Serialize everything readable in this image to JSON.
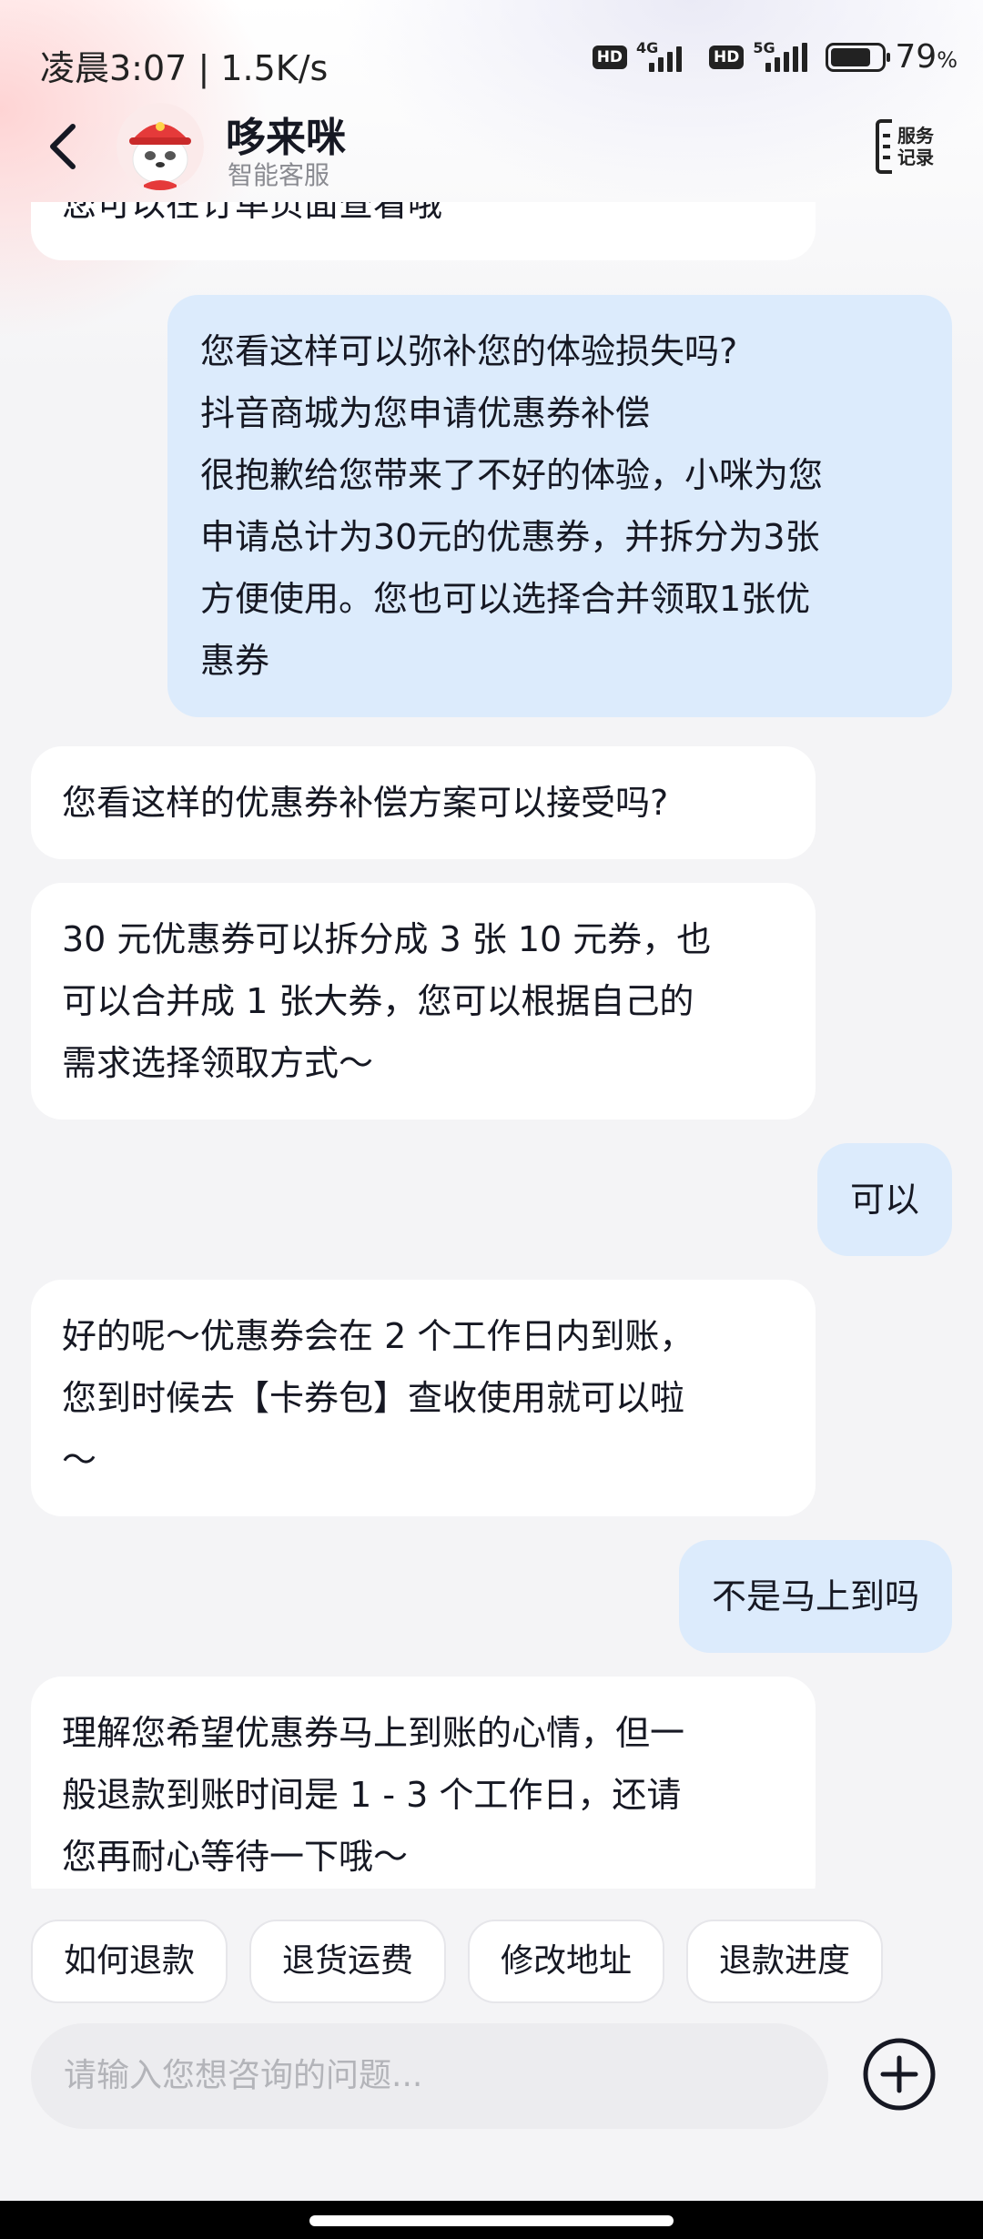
{
  "status_bar": {
    "time": "凌晨3:07",
    "separator": "|",
    "speed": "1.5K/s",
    "hd_label": "HD",
    "network_1": "4G",
    "network_2": "5G",
    "battery_value": "79",
    "battery_unit": "%",
    "battery_level": 0.79
  },
  "header": {
    "back_icon": "chevron-left-icon",
    "bot_name": "哆来咪",
    "bot_subtitle": "智能客服",
    "service_label_line1": "服务",
    "service_label_line2": "记录"
  },
  "messages": [
    {
      "role": "bot",
      "lines": [
        "您可以在订单页面查看哦"
      ]
    },
    {
      "role": "user",
      "lines": [
        "您看这样可以弥补您的体验损失吗?",
        "抖音商城为您申请优惠券补偿",
        "很抱歉给您带来了不好的体验，小咪为您",
        "申请总计为30元的优惠券，并拆分为3张",
        "方便使用。您也可以选择合并领取1张优",
        "惠券"
      ]
    },
    {
      "role": "bot",
      "lines": [
        "您看这样的优惠券补偿方案可以接受吗?"
      ]
    },
    {
      "role": "bot",
      "lines": [
        "30 元优惠券可以拆分成 3 张 10 元券，也",
        "可以合并成 1 张大券，您可以根据自己的",
        "需求选择领取方式～"
      ]
    },
    {
      "role": "user",
      "lines": [
        "可以"
      ]
    },
    {
      "role": "bot",
      "lines": [
        "好的呢～优惠券会在 2 个工作日内到账，",
        "您到时候去【卡券包】查收使用就可以啦",
        "～"
      ]
    },
    {
      "role": "user",
      "lines": [
        "不是马上到吗"
      ]
    },
    {
      "role": "bot",
      "lines": [
        "理解您希望优惠券马上到账的心情，但一",
        "般退款到账时间是 1 - 3 个工作日，还请",
        "您再耐心等待一下哦～"
      ]
    }
  ],
  "quick_replies": [
    "如何退款",
    "退货运费",
    "修改地址",
    "退款进度"
  ],
  "input": {
    "placeholder": "请输入您想咨询的问题..."
  },
  "colors": {
    "user_bubble": "#dcebfc",
    "bot_bubble": "#ffffff",
    "background": "#f4f4f6",
    "avatar_red": "#e53a3a"
  }
}
